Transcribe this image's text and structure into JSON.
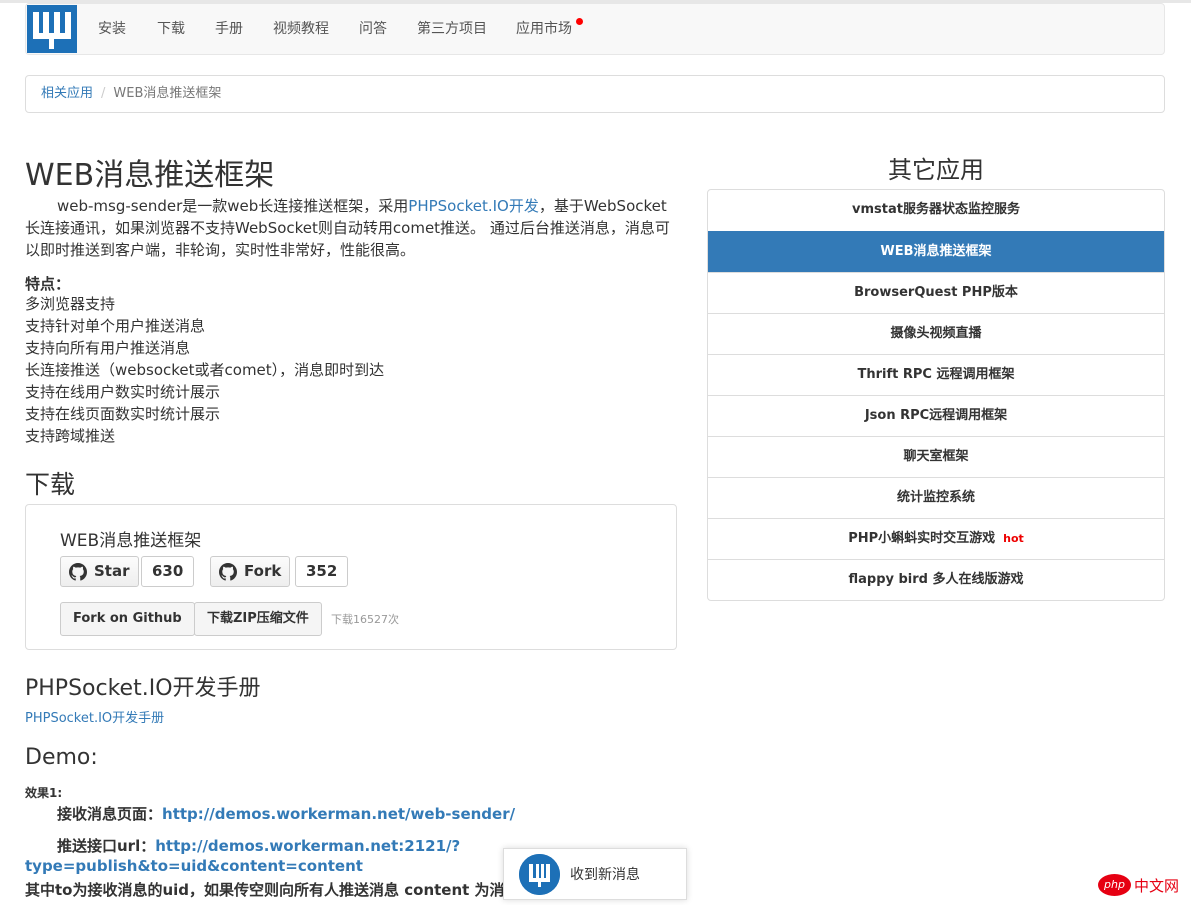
{
  "nav": {
    "items": [
      "安装",
      "下载",
      "手册",
      "视频教程",
      "问答",
      "第三方项目",
      "应用市场"
    ],
    "logo_icon": "workerman-logo-icon"
  },
  "breadcrumb": {
    "parent": "相关应用",
    "separator": "/",
    "current": "WEB消息推送框架"
  },
  "main": {
    "title": "WEB消息推送框架",
    "intro_before": "web-msg-sender是一款web长连接推送框架，采用",
    "intro_link": "PHPSocket.IO开发",
    "intro_after": "，基于WebSocket长连接通讯，如果浏览器不支持WebSocket则自动转用comet推送。 通过后台推送消息，消息可以即时推送到客户端，非轮询，实时性非常好，性能很高。",
    "features_title": "特点：",
    "features": [
      "多浏览器支持",
      "支持针对单个用户推送消息",
      "支持向所有用户推送消息",
      "长连接推送（websocket或者comet），消息即时到达",
      "支持在线用户数实时统计展示",
      "支持在线页面数实时统计展示",
      "支持跨域推送"
    ],
    "download_heading": "下载",
    "download": {
      "title": "WEB消息推送框架",
      "star_label": "Star",
      "star_count": "630",
      "fork_label": "Fork",
      "fork_count": "352",
      "fork_github_label": "Fork on Github",
      "zip_label": "下载ZIP压缩文件",
      "download_count_text": "下载16527次"
    },
    "manual_heading": "PHPSocket.IO开发手册",
    "manual_link": "PHPSocket.IO开发手册",
    "demo_heading": "Demo:",
    "effect_label": "效果1:",
    "receive_label": "接收消息页面：",
    "receive_url": "http://demos.workerman.net/web-sender/",
    "push_label": "推送接口url：",
    "push_url_1": "http://demos.workerman.net:2121/?",
    "push_url_2": "type=publish&to=uid&content=content",
    "note_line": "其中to为接收消息的uid，如果传空则向所有人推送消息 content 为消"
  },
  "sidebar": {
    "title": "其它应用",
    "items": [
      "vmstat服务器状态监控服务",
      "WEB消息推送框架",
      "BrowserQuest PHP版本",
      "摄像头视频直播",
      "Thrift RPC 远程调用框架",
      "Json RPC远程调用框架",
      "聊天室框架",
      "统计监控系统",
      "PHP小蝌蚪实时交互游戏",
      "flappy bird 多人在线版游戏"
    ],
    "hot_label": "hot",
    "active_color": "#337ab7"
  },
  "toast": {
    "text": "收到新消息"
  },
  "watermark": {
    "badge": "php",
    "text": "中文网",
    "color": "#e60012"
  }
}
